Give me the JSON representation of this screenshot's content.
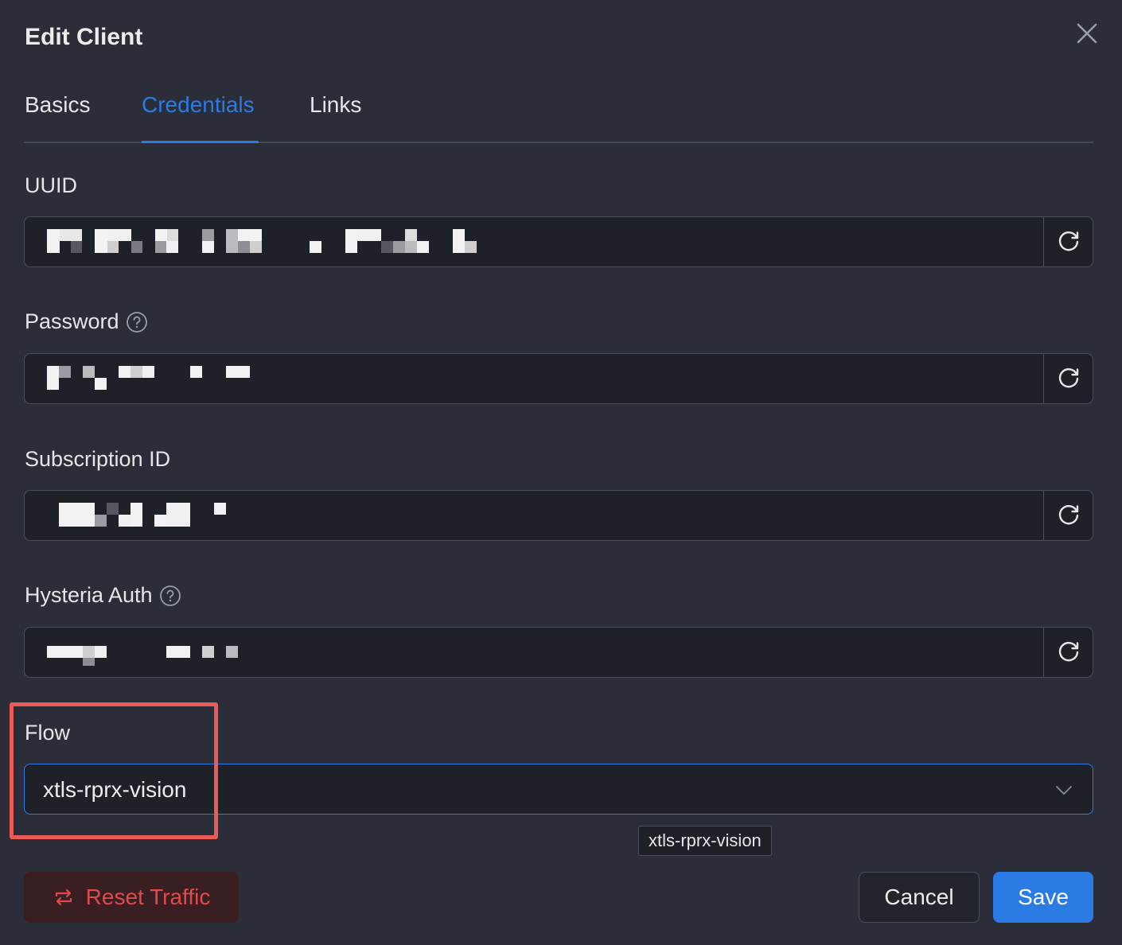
{
  "dialog": {
    "title": "Edit Client",
    "close_icon": "close-icon"
  },
  "tabs": [
    {
      "label": "Basics",
      "active": false
    },
    {
      "label": "Credentials",
      "active": true
    },
    {
      "label": "Links",
      "active": false
    }
  ],
  "fields": {
    "uuid": {
      "label": "UUID",
      "value_redacted": true,
      "action_icon": "refresh-icon"
    },
    "password": {
      "label": "Password",
      "help_icon": "question-circle-icon",
      "value_redacted": true,
      "action_icon": "refresh-icon"
    },
    "subscription_id": {
      "label": "Subscription ID",
      "value_redacted": true,
      "action_icon": "refresh-icon"
    },
    "hysteria_auth": {
      "label": "Hysteria Auth",
      "help_icon": "question-circle-icon",
      "value_redacted": true,
      "action_icon": "refresh-icon"
    },
    "flow": {
      "label": "Flow",
      "selected": "xtls-rprx-vision",
      "chevron_icon": "chevron-down-icon"
    }
  },
  "tooltip": {
    "text": "xtls-rprx-vision"
  },
  "buttons": {
    "reset_traffic": "Reset Traffic",
    "cancel": "Cancel",
    "save": "Save"
  },
  "colors": {
    "background": "#2b2e38",
    "field_background": "#1f2128",
    "accent": "#2b7be5",
    "danger": "#e2494a",
    "danger_background": "#3a1f22",
    "highlight": "#ec5a56"
  }
}
